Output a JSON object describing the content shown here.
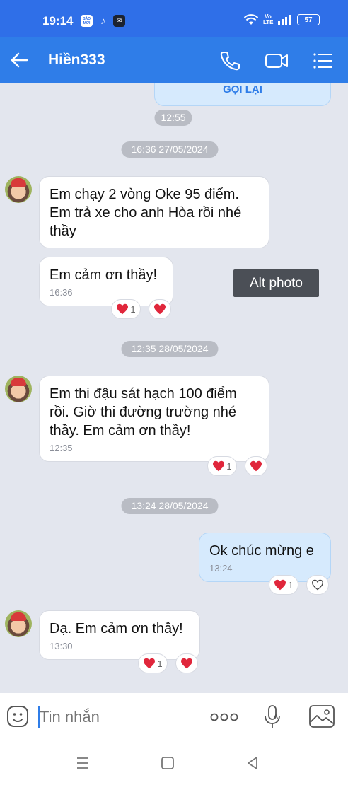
{
  "status_bar": {
    "time": "19:14",
    "app1": "BÁO MỚI",
    "app2": "♪",
    "app3": "✉",
    "volte": "Vo LTE",
    "battery": "57"
  },
  "header": {
    "title": "Hiền333"
  },
  "chat": {
    "call_card_label": "GỌI LẠI",
    "call_time": "12:55",
    "date1": "16:36 27/05/2024",
    "msg1_text": "Em chạy 2 vòng Oke 95 điểm. Em trả xe cho anh Hòa rồi nhé thầy",
    "msg2_text": "Em cảm ơn thầy!",
    "msg2_time": "16:36",
    "msg2_react_count": "1",
    "date2": "12:35 28/05/2024",
    "msg3_text": "Em thi đậu sát hạch 100 điểm rồi. Giờ thi đường trường nhé thầy. Em cảm ơn thầy!",
    "msg3_time": "12:35",
    "msg3_react_count": "1",
    "date3": "13:24 28/05/2024",
    "msg4_text": "Ok chúc mừng e",
    "msg4_time": "13:24",
    "msg4_react_count": "1",
    "msg5_text": "Dạ. Em cảm ơn thầy!",
    "msg5_time": "13:30",
    "msg5_react_count": "1"
  },
  "tooltip": "Alt photo",
  "input": {
    "placeholder": "Tin nhắn"
  },
  "colors": {
    "header": "#2f7de8",
    "status": "#2f6fe8",
    "chat_bg": "#e3e6ee",
    "my_bubble": "#d6eafd",
    "heart": "#e0263b"
  }
}
